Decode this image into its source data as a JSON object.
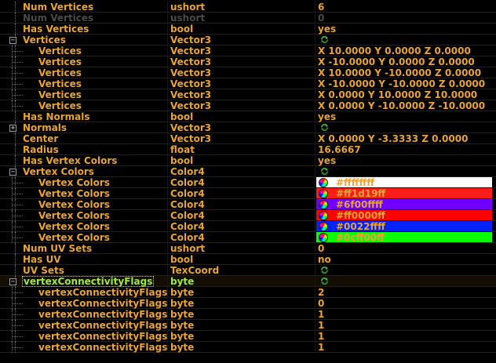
{
  "rows": [
    {
      "name": "Num Vertices",
      "type": "ushort",
      "value": "6",
      "level": 0,
      "style": "normal"
    },
    {
      "name": "Num Vertices",
      "type": "ushort",
      "value": "0",
      "level": 0,
      "style": "dim"
    },
    {
      "name": "Has Vertices",
      "type": "bool",
      "value": "yes",
      "level": 0,
      "style": "normal"
    },
    {
      "name": "Vertices",
      "type": "Vector3",
      "value": "",
      "icon": "refresh-icon",
      "level": 0,
      "toggle": "−",
      "style": "normal"
    },
    {
      "name": "Vertices",
      "type": "Vector3",
      "value": "X 10.0000 Y 0.0000 Z 0.0000",
      "level": 1,
      "style": "normal"
    },
    {
      "name": "Vertices",
      "type": "Vector3",
      "value": "X -10.0000 Y 0.0000 Z 0.0000",
      "level": 1,
      "style": "normal"
    },
    {
      "name": "Vertices",
      "type": "Vector3",
      "value": "X 10.0000 Y -10.0000 Z 0.0000",
      "level": 1,
      "style": "normal"
    },
    {
      "name": "Vertices",
      "type": "Vector3",
      "value": "X -10.0000 Y -10.0000 Z 0.0000",
      "level": 1,
      "style": "normal"
    },
    {
      "name": "Vertices",
      "type": "Vector3",
      "value": "X 0.0000 Y 10.0000 Z 10.0000",
      "level": 1,
      "style": "normal"
    },
    {
      "name": "Vertices",
      "type": "Vector3",
      "value": "X 0.0000 Y -10.0000 Z -10.0000",
      "level": 1,
      "style": "normal"
    },
    {
      "name": "Has Normals",
      "type": "bool",
      "value": "yes",
      "level": 0,
      "style": "normal"
    },
    {
      "name": "Normals",
      "type": "Vector3",
      "value": "",
      "icon": "refresh-icon",
      "level": 0,
      "toggle": "+",
      "style": "normal"
    },
    {
      "name": "Center",
      "type": "Vector3",
      "value": "X 0.0000 Y -3.3333 Z 0.0000",
      "level": 0,
      "style": "normal"
    },
    {
      "name": "Radius",
      "type": "float",
      "value": "16.6667",
      "level": 0,
      "style": "normal"
    },
    {
      "name": "Has Vertex Colors",
      "type": "bool",
      "value": "yes",
      "level": 0,
      "style": "normal"
    },
    {
      "name": "Vertex Colors",
      "type": "Color4",
      "value": "",
      "icon": "refresh-icon",
      "level": 0,
      "toggle": "−",
      "style": "normal"
    },
    {
      "name": "Vertex Colors",
      "type": "Color4",
      "value": "#ffffffff",
      "swatch": "#ffffff",
      "level": 1,
      "style": "normal"
    },
    {
      "name": "Vertex Colors",
      "type": "Color4",
      "value": "#ff1d19ff",
      "swatch": "#ff1d19",
      "level": 1,
      "style": "normal"
    },
    {
      "name": "Vertex Colors",
      "type": "Color4",
      "value": "#6f00ffff",
      "swatch": "#6f00ff",
      "level": 1,
      "style": "normal"
    },
    {
      "name": "Vertex Colors",
      "type": "Color4",
      "value": "#ff0000ff",
      "swatch": "#ff0000",
      "level": 1,
      "style": "normal"
    },
    {
      "name": "Vertex Colors",
      "type": "Color4",
      "value": "#0022ffff",
      "swatch": "#0022ff",
      "level": 1,
      "style": "normal"
    },
    {
      "name": "Vertex Colors",
      "type": "Color4",
      "value": "#0cff00ff",
      "swatch": "#0cff00",
      "level": 1,
      "style": "normal"
    },
    {
      "name": "Num UV Sets",
      "type": "ushort",
      "value": "0",
      "level": 0,
      "style": "normal"
    },
    {
      "name": "Has UV",
      "type": "bool",
      "value": "no",
      "level": 0,
      "style": "normal"
    },
    {
      "name": "UV Sets",
      "type": "TexCoord",
      "value": "",
      "icon": "refresh-icon",
      "level": 0,
      "style": "normal"
    },
    {
      "name": "vertexConnectivityFlags",
      "type": "byte",
      "value": "",
      "icon": "refresh-icon",
      "level": 0,
      "toggle": "−",
      "style": "selected"
    },
    {
      "name": "vertexConnectivityFlags",
      "type": "byte",
      "value": "2",
      "level": 1,
      "style": "normal"
    },
    {
      "name": "vertexConnectivityFlags",
      "type": "byte",
      "value": "0",
      "level": 1,
      "style": "normal"
    },
    {
      "name": "vertexConnectivityFlags",
      "type": "byte",
      "value": "1",
      "level": 1,
      "style": "normal"
    },
    {
      "name": "vertexConnectivityFlags",
      "type": "byte",
      "value": "1",
      "level": 1,
      "style": "normal"
    },
    {
      "name": "vertexConnectivityFlags",
      "type": "byte",
      "value": "1",
      "level": 1,
      "style": "normal"
    },
    {
      "name": "vertexConnectivityFlags",
      "type": "byte",
      "value": "1",
      "level": 1,
      "style": "normal"
    }
  ],
  "colors": {
    "text": "#e8a33a",
    "selected": "#9ee847",
    "dim": "#4a4a4a",
    "background": "#000000"
  }
}
